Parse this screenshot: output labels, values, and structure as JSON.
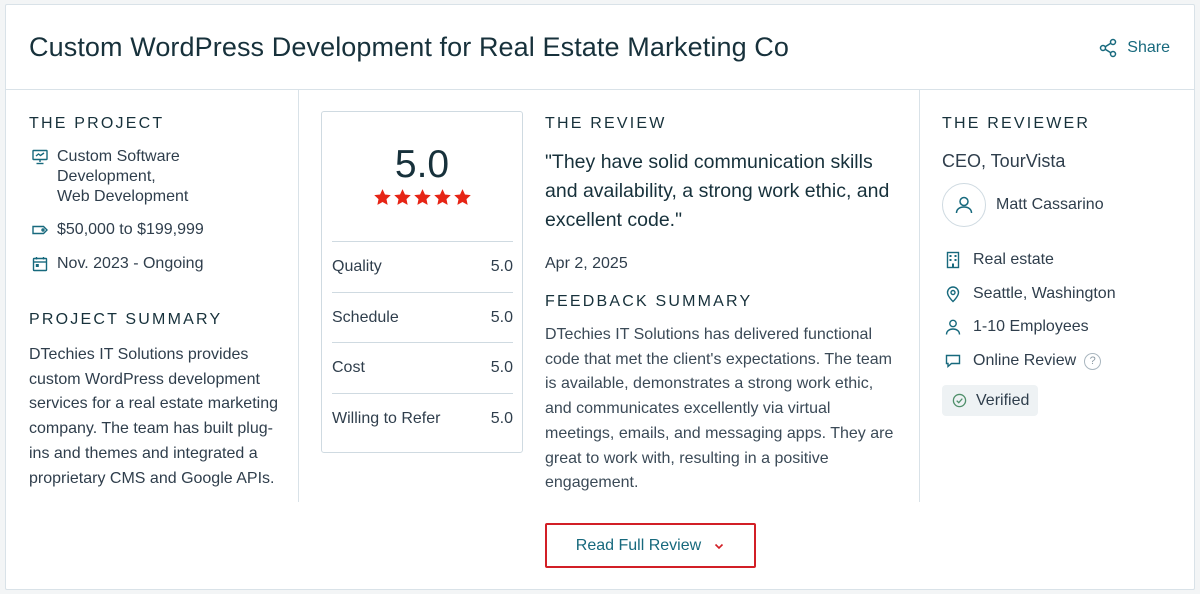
{
  "header": {
    "title": "Custom WordPress Development for Real Estate Marketing Co",
    "share_label": "Share"
  },
  "project": {
    "section_label": "THE PROJECT",
    "services": "Custom Software Development, Web Development",
    "services_lines": [
      "Custom Software",
      "Development,",
      "Web Development"
    ],
    "budget": "$50,000 to $199,999",
    "timeline": "Nov. 2023 - Ongoing",
    "summary_label": "PROJECT SUMMARY",
    "summary": "DTechies IT Solutions provides custom WordPress development services for a real estate marketing company. The team has built plug-ins and themes and integrated a proprietary CMS and Google APIs."
  },
  "rating": {
    "overall": "5.0",
    "stars": 5,
    "star_color": "#e62415",
    "rows": [
      {
        "label": "Quality",
        "value": "5.0"
      },
      {
        "label": "Schedule",
        "value": "5.0"
      },
      {
        "label": "Cost",
        "value": "5.0"
      },
      {
        "label": "Willing to Refer",
        "value": "5.0"
      }
    ]
  },
  "review": {
    "section_label": "THE REVIEW",
    "quote": "\"They have solid communication skills and availability, a strong work ethic, and excellent code.\"",
    "date": "Apr 2, 2025",
    "feedback_label": "FEEDBACK SUMMARY",
    "feedback": "DTechies IT Solutions has delivered functional code that met the client's expectations. The team is available, demonstrates a strong work ethic, and communicates excellently via virtual meetings, emails, and messaging apps. They are great to work with, resulting in a positive engagement."
  },
  "reviewer": {
    "section_label": "THE REVIEWER",
    "role": "CEO, TourVista",
    "name": "Matt Cassarino",
    "industry": "Real estate",
    "location": "Seattle, Washington",
    "size": "1-10 Employees",
    "review_type": "Online Review",
    "help_label": "?",
    "verified_label": "Verified"
  },
  "actions": {
    "read_full_review": "Read Full Review"
  },
  "colors": {
    "accent_link": "#17697d",
    "button_border": "#d21f26",
    "star": "#e62415",
    "verified_check": "#4f8f6a"
  }
}
